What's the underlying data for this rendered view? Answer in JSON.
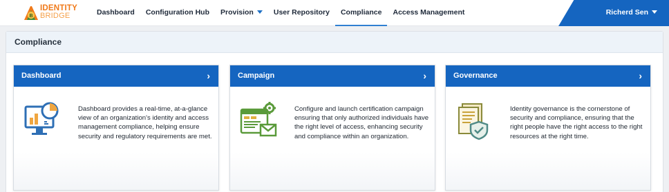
{
  "brand": {
    "line1": "IDENTITY",
    "line2": "BRIDGE",
    "emblem_letter": "B"
  },
  "nav": {
    "items": [
      {
        "label": "Dashboard",
        "dropdown": false,
        "active": false
      },
      {
        "label": "Configuration Hub",
        "dropdown": false,
        "active": false
      },
      {
        "label": "Provision",
        "dropdown": true,
        "active": false
      },
      {
        "label": "User Repository",
        "dropdown": false,
        "active": false
      },
      {
        "label": "Compliance",
        "dropdown": false,
        "active": true
      },
      {
        "label": "Access Management",
        "dropdown": false,
        "active": false
      }
    ]
  },
  "user": {
    "name": "Richerd Sen"
  },
  "page": {
    "title": "Compliance"
  },
  "cards": [
    {
      "title": "Dashboard",
      "description": "Dashboard provides a real-time, at-a-glance view of an organization's identity and access management compliance, helping ensure security and regulatory requirements are met.",
      "icon": "monitor-chart-icon"
    },
    {
      "title": "Campaign",
      "description": "Configure and launch certification campaign ensuring that only authorized individuals have the right level of access, enhancing security and compliance within an organization.",
      "icon": "campaign-gear-mail-icon"
    },
    {
      "title": "Governance",
      "description": "Identity governance is the cornerstone of security and compliance, ensuring that the right people have the right access to the right resources at the right time.",
      "icon": "documents-shield-icon"
    }
  ],
  "colors": {
    "accent": "#1565c0",
    "brand_orange": "#f07a1a",
    "dashboard_icon_blue": "#2e6fb5",
    "dashboard_icon_orange": "#f0a640",
    "campaign_icon_green": "#5a9a3a",
    "governance_icon_olive": "#8a8a3a"
  }
}
